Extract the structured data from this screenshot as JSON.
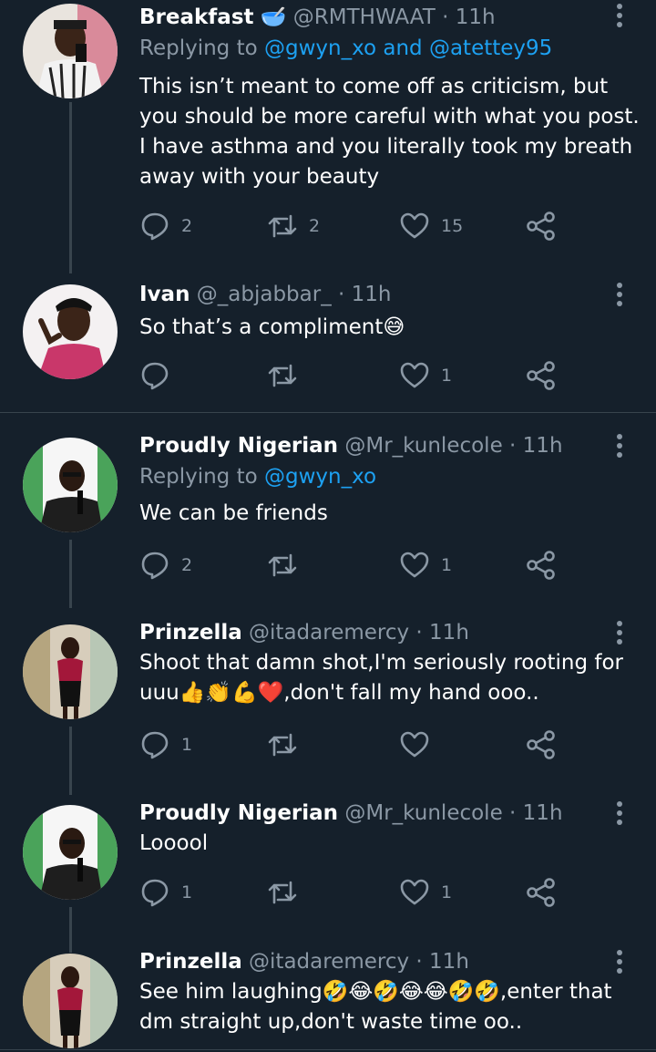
{
  "icons": {
    "reply": "reply-icon",
    "retweet": "retweet-icon",
    "like": "heart-icon",
    "share": "share-icon",
    "more": "more-vertical-icon"
  },
  "colors": {
    "background": "#15202b",
    "name": "#ffffff",
    "secondary": "#8b98a5",
    "mention": "#1da1f2",
    "divider": "#38444d"
  },
  "tweets": [
    {
      "name": "Breakfast",
      "name_emoji": "🥣",
      "handle": "@RMTHWAAT",
      "dot": "·",
      "time": "11h",
      "replying_prefix": "Replying to",
      "replying_mentions": "@gwyn_xo and @atetteу95",
      "text": "This isn’t meant to come off as criticism, but you should be more careful with what you post. I have asthma and you literally took my breath away with your beauty",
      "replies": "2",
      "retweets": "2",
      "likes": "15"
    },
    {
      "name": "Ivan",
      "handle": "@_abjabbar_",
      "dot": "·",
      "time": "11h",
      "text": "So that’s a compliment",
      "text_emoji": "😅",
      "replies": "",
      "retweets": "",
      "likes": "1"
    },
    {
      "name": "Proudly Nigerian",
      "handle": "@Mr_kunlecole",
      "dot": "·",
      "time": "11h",
      "replying_prefix": "Replying to",
      "replying_mentions": "@gwyn_xo",
      "text": "We can be friends",
      "replies": "2",
      "retweets": "",
      "likes": "1"
    },
    {
      "name": "Prinzella",
      "handle": "@itadaremercy",
      "dot": "·",
      "time": "11h",
      "text_line1": "Shoot that damn shot,I'm seriously rooting for",
      "text_line2_pre": "uuu",
      "text_line2_emojis": "👍👏💪❤️",
      "text_line2_post": ",don't fall my hand ooo..",
      "replies": "1",
      "retweets": "",
      "likes": ""
    },
    {
      "name": "Proudly Nigerian",
      "handle": "@Mr_kunlecole",
      "dot": "·",
      "time": "11h",
      "text": "Looool",
      "replies": "1",
      "retweets": "",
      "likes": "1"
    },
    {
      "name": "Prinzella",
      "handle": "@itadaremercy",
      "dot": "·",
      "time": "11h",
      "text_line1_pre": "See him laughing",
      "text_line1_emojis": "🤣😂🤣😂😂🤣🤣",
      "text_line1_post": ",enter that",
      "text_line2": "dm straight up,don't waste time oo.."
    }
  ]
}
